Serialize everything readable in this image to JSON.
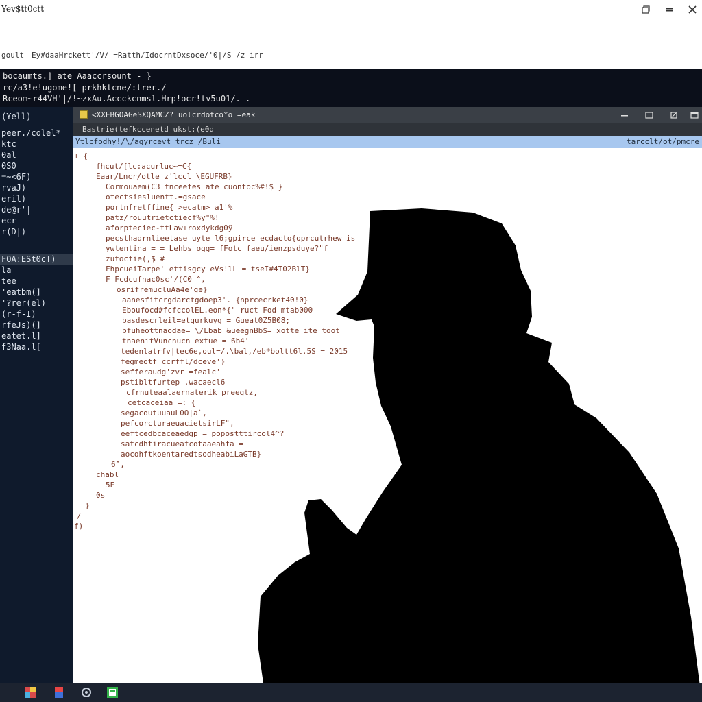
{
  "window": {
    "title": "Yev$tt0ctt"
  },
  "pathbar": {
    "segments": [
      "goult",
      "Ey#daaHrckett'/V/ =Ratth/Idocrnt",
      "Dxsoce/'0|/S /z irr"
    ]
  },
  "terminal": {
    "lines": [
      "bocaumts.]  ate Aaaccrsount    -  }",
      "rc/a3!e!ugome![ prkhktcne/:trer./",
      "Rceom~r44VH'|/!~zxAu.Accckcnmsl.Hrp!ocr!tv5u01/. ."
    ]
  },
  "sidebar": {
    "items": [
      "(Yell)",
      "",
      "peer./colel*",
      "ktc",
      "0al",
      "0S0",
      "=~<6F)",
      "rvaJ)",
      "eril)",
      "de@r'|",
      "ecr",
      "r(D|)",
      "FOA:ESt0cT)",
      "la",
      "tee",
      "'eatbm(]",
      "'?rer(el)",
      "(r-f-I)",
      "rfeJs)(]",
      "eatet.l]",
      "f3Naa.l["
    ],
    "selected_index": 12
  },
  "inner_window": {
    "title": "<XXEBGOAGeSXQAMCZ? uolcrdotco*o =eak",
    "tab": "Bastrie(tefkccenetd ukst:(e0d",
    "address_left": "Ytlcfodhy!/\\/agyrcevt trcz /Buli",
    "address_right": "tarcclt/ot/pmcre"
  },
  "code_lines": [
    "+ {",
    "fhcut/[lc:acurluc~=C{",
    "Eaar/Lncr/otle z'lccl \\EGUFRB}",
    "Cormouaem(C3 tnceefes ate cuontoc%#!$ }",
    "otectsiesluentt.=gsace",
    "portnfretffine{ >ecatm> a1'%",
    "patz/rouutrietctiecf%y\"%!",
    "aforpteciec-ttLaw+roxdykdg0ÿ",
    "pecsthadrnlieetase uyte l6;gpirce ecdacto{oprcutrhew is",
    "ywtentina = = Lehbs ogg= fFotc faeu/ienzpsduye?\"f",
    "zutocfie(,$ #",
    "FhpcueiTarpe' ettisgcy eVs!lL = tseI#4T02BlT}",
    "F Fcdcufnac0sc'/(C0 ^,",
    "osrifremucluAa4e'ge}",
    "aanesfitcrgdarctgdoep3'. {nprcecrket40!0}",
    "Eboufocd#fcfccolEL.eon*{\"  ruct Fod  mtab000",
    "basdescrleil=etgurkuyg = Gueat0Z5B08;",
    "bfuheottnaodae= \\/Lbab &ueegnBb$= xotte ite toot",
    "tnaenitVuncnucn extue = 6b4'",
    "tedenlatrfv|tec6e,oul=/.\\bal,/eb*boltt6l.5S = 2015",
    "fegmeotf ccrffl/dceve'}",
    "sefferaudg'zvr =fealc'",
    "pstibltfurtep .wacaecl6",
    "cfrnuteaalaernaterik preegtz,",
    "cetcaceiaa =: {",
    "segacoutuuauL0Ö|a`,",
    "pefcorcturaeuacietsirLF\",",
    "eeftcedbcaceaedgp = popostttircol4^?",
    "satcdhtiracueafcotaaeahfa =",
    "aocohftkoentaredtsodheabiLaGTB}",
    "6^,",
    "chabl",
    "5E",
    "0s",
    "}",
    "/",
    "f)"
  ],
  "taskbar": {
    "icons": [
      "app-icon-1",
      "app-icon-2",
      "settings-icon",
      "editor-icon"
    ]
  },
  "colors": {
    "sidebar_bg": "#0f1a2c",
    "terminal_bg": "#0b0f1a",
    "address_bg": "#a7c7ef",
    "code_text": "#7a3a2a",
    "silhouette": "#000000"
  }
}
